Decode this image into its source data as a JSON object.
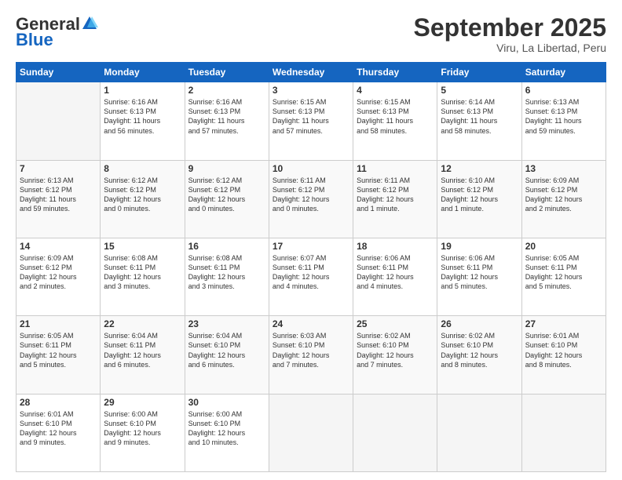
{
  "header": {
    "logo_general": "General",
    "logo_blue": "Blue",
    "month_title": "September 2025",
    "location": "Viru, La Libertad, Peru"
  },
  "weekdays": [
    "Sunday",
    "Monday",
    "Tuesday",
    "Wednesday",
    "Thursday",
    "Friday",
    "Saturday"
  ],
  "weeks": [
    [
      {
        "day": "",
        "info": ""
      },
      {
        "day": "1",
        "info": "Sunrise: 6:16 AM\nSunset: 6:13 PM\nDaylight: 11 hours\nand 56 minutes."
      },
      {
        "day": "2",
        "info": "Sunrise: 6:16 AM\nSunset: 6:13 PM\nDaylight: 11 hours\nand 57 minutes."
      },
      {
        "day": "3",
        "info": "Sunrise: 6:15 AM\nSunset: 6:13 PM\nDaylight: 11 hours\nand 57 minutes."
      },
      {
        "day": "4",
        "info": "Sunrise: 6:15 AM\nSunset: 6:13 PM\nDaylight: 11 hours\nand 58 minutes."
      },
      {
        "day": "5",
        "info": "Sunrise: 6:14 AM\nSunset: 6:13 PM\nDaylight: 11 hours\nand 58 minutes."
      },
      {
        "day": "6",
        "info": "Sunrise: 6:13 AM\nSunset: 6:13 PM\nDaylight: 11 hours\nand 59 minutes."
      }
    ],
    [
      {
        "day": "7",
        "info": "Sunrise: 6:13 AM\nSunset: 6:12 PM\nDaylight: 11 hours\nand 59 minutes."
      },
      {
        "day": "8",
        "info": "Sunrise: 6:12 AM\nSunset: 6:12 PM\nDaylight: 12 hours\nand 0 minutes."
      },
      {
        "day": "9",
        "info": "Sunrise: 6:12 AM\nSunset: 6:12 PM\nDaylight: 12 hours\nand 0 minutes."
      },
      {
        "day": "10",
        "info": "Sunrise: 6:11 AM\nSunset: 6:12 PM\nDaylight: 12 hours\nand 0 minutes."
      },
      {
        "day": "11",
        "info": "Sunrise: 6:11 AM\nSunset: 6:12 PM\nDaylight: 12 hours\nand 1 minute."
      },
      {
        "day": "12",
        "info": "Sunrise: 6:10 AM\nSunset: 6:12 PM\nDaylight: 12 hours\nand 1 minute."
      },
      {
        "day": "13",
        "info": "Sunrise: 6:09 AM\nSunset: 6:12 PM\nDaylight: 12 hours\nand 2 minutes."
      }
    ],
    [
      {
        "day": "14",
        "info": "Sunrise: 6:09 AM\nSunset: 6:12 PM\nDaylight: 12 hours\nand 2 minutes."
      },
      {
        "day": "15",
        "info": "Sunrise: 6:08 AM\nSunset: 6:11 PM\nDaylight: 12 hours\nand 3 minutes."
      },
      {
        "day": "16",
        "info": "Sunrise: 6:08 AM\nSunset: 6:11 PM\nDaylight: 12 hours\nand 3 minutes."
      },
      {
        "day": "17",
        "info": "Sunrise: 6:07 AM\nSunset: 6:11 PM\nDaylight: 12 hours\nand 4 minutes."
      },
      {
        "day": "18",
        "info": "Sunrise: 6:06 AM\nSunset: 6:11 PM\nDaylight: 12 hours\nand 4 minutes."
      },
      {
        "day": "19",
        "info": "Sunrise: 6:06 AM\nSunset: 6:11 PM\nDaylight: 12 hours\nand 5 minutes."
      },
      {
        "day": "20",
        "info": "Sunrise: 6:05 AM\nSunset: 6:11 PM\nDaylight: 12 hours\nand 5 minutes."
      }
    ],
    [
      {
        "day": "21",
        "info": "Sunrise: 6:05 AM\nSunset: 6:11 PM\nDaylight: 12 hours\nand 5 minutes."
      },
      {
        "day": "22",
        "info": "Sunrise: 6:04 AM\nSunset: 6:11 PM\nDaylight: 12 hours\nand 6 minutes."
      },
      {
        "day": "23",
        "info": "Sunrise: 6:04 AM\nSunset: 6:10 PM\nDaylight: 12 hours\nand 6 minutes."
      },
      {
        "day": "24",
        "info": "Sunrise: 6:03 AM\nSunset: 6:10 PM\nDaylight: 12 hours\nand 7 minutes."
      },
      {
        "day": "25",
        "info": "Sunrise: 6:02 AM\nSunset: 6:10 PM\nDaylight: 12 hours\nand 7 minutes."
      },
      {
        "day": "26",
        "info": "Sunrise: 6:02 AM\nSunset: 6:10 PM\nDaylight: 12 hours\nand 8 minutes."
      },
      {
        "day": "27",
        "info": "Sunrise: 6:01 AM\nSunset: 6:10 PM\nDaylight: 12 hours\nand 8 minutes."
      }
    ],
    [
      {
        "day": "28",
        "info": "Sunrise: 6:01 AM\nSunset: 6:10 PM\nDaylight: 12 hours\nand 9 minutes."
      },
      {
        "day": "29",
        "info": "Sunrise: 6:00 AM\nSunset: 6:10 PM\nDaylight: 12 hours\nand 9 minutes."
      },
      {
        "day": "30",
        "info": "Sunrise: 6:00 AM\nSunset: 6:10 PM\nDaylight: 12 hours\nand 10 minutes."
      },
      {
        "day": "",
        "info": ""
      },
      {
        "day": "",
        "info": ""
      },
      {
        "day": "",
        "info": ""
      },
      {
        "day": "",
        "info": ""
      }
    ]
  ]
}
